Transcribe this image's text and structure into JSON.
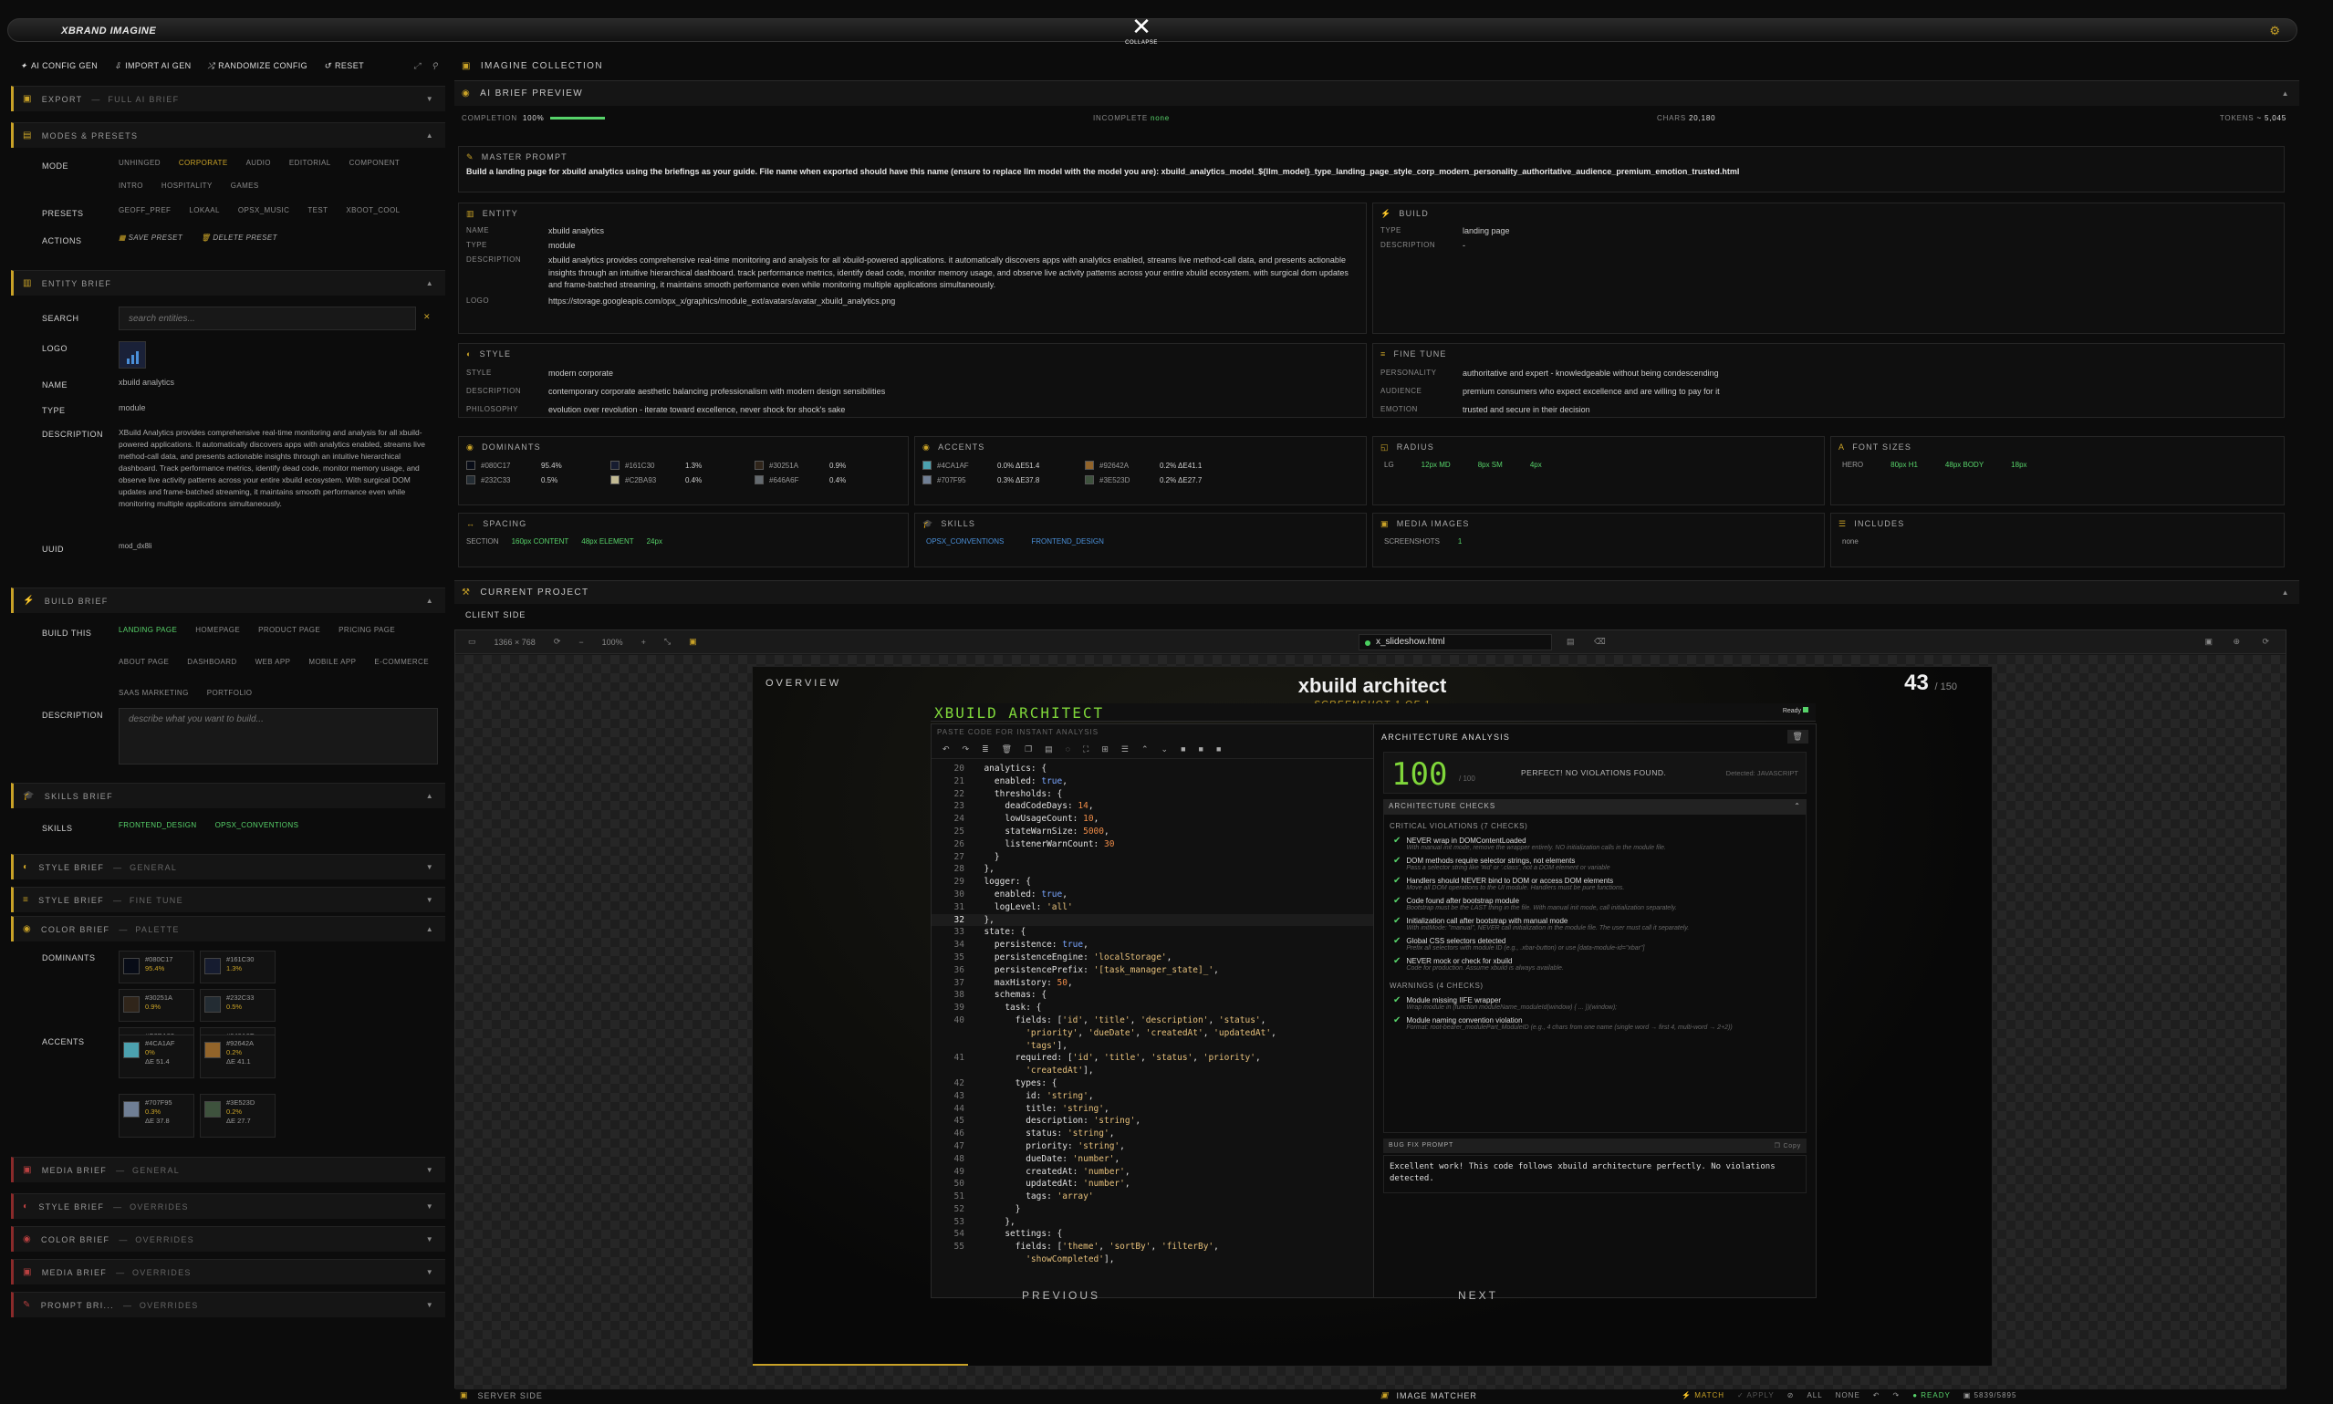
{
  "app": {
    "brand": "XBRAND IMAGINE",
    "collapse": "COLLAPSE"
  },
  "toolbar": {
    "ai_config": "AI CONFIG GEN",
    "import": "IMPORT AI GEN",
    "randomize": "RANDOMIZE CONFIG",
    "reset": "RESET"
  },
  "left": {
    "export": {
      "title": "EXPORT",
      "sub": "FULL AI BRIEF"
    },
    "modes": {
      "title": "MODES & PRESETS",
      "mode_label": "MODE",
      "modes": [
        "UNHINGED",
        "CORPORATE",
        "AUDIO",
        "EDITORIAL",
        "COMPONENT",
        "INTRO",
        "HOSPITALITY",
        "GAMES"
      ],
      "presets_label": "PRESETS",
      "presets": [
        "GEOFF_PREF",
        "LOKAAL",
        "OPSX_MUSIC",
        "TEST",
        "XBOOT_COOL"
      ],
      "actions_label": "ACTIONS",
      "save": "SAVE PRESET",
      "delete": "DELETE PRESET"
    },
    "entity": {
      "title": "ENTITY BRIEF",
      "search_label": "SEARCH",
      "search_placeholder": "search entities...",
      "logo_label": "LOGO",
      "name_label": "NAME",
      "name": "xbuild analytics",
      "type_label": "TYPE",
      "type": "module",
      "desc_label": "DESCRIPTION",
      "desc": "XBuild Analytics provides comprehensive real-time monitoring and analysis for all xbuild-powered applications. It automatically discovers apps with analytics enabled, streams live method-call data, and presents actionable insights through an intuitive hierarchical dashboard. Track performance metrics, identify dead code, monitor memory usage, and observe live activity patterns across your entire xbuild ecosystem. With surgical DOM updates and frame-batched streaming, it maintains smooth performance even while monitoring multiple applications simultaneously.",
      "uuid_label": "UUID",
      "uuid": "mod_dx8li"
    },
    "build": {
      "title": "BUILD BRIEF",
      "build_label": "BUILD THIS",
      "items": [
        "LANDING PAGE",
        "HOMEPAGE",
        "PRODUCT PAGE",
        "PRICING PAGE",
        "ABOUT PAGE",
        "DASHBOARD",
        "WEB APP",
        "MOBILE APP",
        "E-COMMERCE",
        "SAAS MARKETING",
        "PORTFOLIO"
      ],
      "desc_label": "DESCRIPTION",
      "desc_placeholder": "describe what you want to build..."
    },
    "skills": {
      "title": "SKILLS BRIEF",
      "label": "SKILLS",
      "items": [
        "FRONTEND_DESIGN",
        "OPSX_CONVENTIONS"
      ]
    },
    "style_general": {
      "title": "STYLE BRIEF",
      "sub": "GENERAL"
    },
    "style_fine": {
      "title": "STYLE BRIEF",
      "sub": "FINE TUNE"
    },
    "color": {
      "title": "COLOR BRIEF",
      "sub": "PALETTE",
      "dom_label": "DOMINANTS",
      "accent_label": "ACCENTS",
      "dominants": [
        {
          "hex": "#080C17",
          "pct": "95.4%",
          "color": "#080C17"
        },
        {
          "hex": "#161C30",
          "pct": "1.3%",
          "color": "#161C30"
        },
        {
          "hex": "#30251A",
          "pct": "0.9%",
          "color": "#30251A"
        },
        {
          "hex": "#232C33",
          "pct": "0.5%",
          "color": "#232C33"
        },
        {
          "hex": "#C2BA93",
          "pct": "0.4%",
          "color": "#C2BA93"
        },
        {
          "hex": "#646A6F",
          "pct": "0.4%",
          "color": "#646A6F"
        }
      ],
      "accents": [
        {
          "hex": "#4CA1AF",
          "pct": "0%",
          "de": "ΔE 51.4",
          "color": "#4CA1AF"
        },
        {
          "hex": "#92642A",
          "pct": "0.2%",
          "de": "ΔE 41.1",
          "color": "#92642A"
        },
        {
          "hex": "#707F95",
          "pct": "0.3%",
          "de": "ΔE 37.8",
          "color": "#707F95"
        },
        {
          "hex": "#3E523D",
          "pct": "0.2%",
          "de": "ΔE 27.7",
          "color": "#3E523D"
        }
      ]
    },
    "media_general": {
      "title": "MEDIA BRIEF",
      "sub": "GENERAL"
    },
    "style_over": {
      "title": "STYLE BRIEF",
      "sub": "OVERRIDES"
    },
    "color_over": {
      "title": "COLOR BRIEF",
      "sub": "OVERRIDES"
    },
    "media_over": {
      "title": "MEDIA BRIEF",
      "sub": "OVERRIDES"
    },
    "prompt_over": {
      "title": "PROMPT BRI...",
      "sub": "OVERRIDES"
    }
  },
  "right": {
    "collection": "IMAGINE COLLECTION",
    "preview": "AI BRIEF PREVIEW",
    "stats": {
      "completion_label": "COMPLETION",
      "completion": "100%",
      "completion_frac": 1.0,
      "incomplete_label": "INCOMPLETE",
      "incomplete": "none",
      "chars_label": "CHARS",
      "chars": "20,180",
      "tokens_label": "TOKENS",
      "tokens": "~ 5,045"
    },
    "master": {
      "title": "MASTER PROMPT",
      "text": "Build a landing page for xbuild analytics using the briefings as your guide. File name when exported should have this name (ensure to replace llm model with the model you are): xbuild_analytics_model_${llm_model}_type_landing_page_style_corp_modern_personality_authoritative_audience_premium_emotion_trusted.html"
    },
    "entity": {
      "title": "ENTITY",
      "name_k": "NAME",
      "name": "xbuild analytics",
      "type_k": "TYPE",
      "type": "module",
      "desc_k": "DESCRIPTION",
      "desc": "xbuild analytics provides comprehensive real-time monitoring and analysis for all xbuild-powered applications. it automatically discovers apps with analytics enabled, streams live method-call data, and presents actionable insights through an intuitive hierarchical dashboard. track performance metrics, identify dead code, monitor memory usage, and observe live activity patterns across your entire xbuild ecosystem. with surgical dom updates and frame-batched streaming, it maintains smooth performance even while monitoring multiple applications simultaneously.",
      "logo_k": "LOGO",
      "logo": "https://storage.googleapis.com/opx_x/graphics/module_ext/avatars/avatar_xbuild_analytics.png"
    },
    "build": {
      "title": "BUILD",
      "type_k": "TYPE",
      "type": "landing page",
      "desc_k": "DESCRIPTION",
      "desc": "-"
    },
    "style": {
      "title": "STYLE",
      "style_k": "STYLE",
      "style": "modern corporate",
      "desc_k": "DESCRIPTION",
      "desc": "contemporary corporate aesthetic balancing professionalism with modern design sensibilities",
      "phil_k": "PHILOSOPHY",
      "phil": "evolution over revolution - iterate toward excellence, never shock for shock's sake"
    },
    "fine": {
      "title": "FINE TUNE",
      "pers_k": "PERSONALITY",
      "pers": "authoritative and expert - knowledgeable without being condescending",
      "aud_k": "AUDIENCE",
      "aud": "premium consumers who expect excellence and are willing to pay for it",
      "emo_k": "EMOTION",
      "emo": "trusted and secure in their decision"
    },
    "dominants": {
      "title": "DOMINANTS",
      "items": [
        {
          "hex": "#080C17",
          "pct": "95.4%",
          "color": "#080C17"
        },
        {
          "hex": "#161C30",
          "pct": "1.3%",
          "color": "#161C30"
        },
        {
          "hex": "#30251A",
          "pct": "0.9%",
          "color": "#30251A"
        },
        {
          "hex": "#232C33",
          "pct": "0.5%",
          "color": "#232C33"
        },
        {
          "hex": "#C2BA93",
          "pct": "0.4%",
          "color": "#C2BA93"
        },
        {
          "hex": "#646A6F",
          "pct": "0.4%",
          "color": "#646A6F"
        }
      ]
    },
    "accents": {
      "title": "ACCENTS",
      "items": [
        {
          "hex": "#4CA1AF",
          "pct": "0.0% ΔE51.4",
          "color": "#4CA1AF"
        },
        {
          "hex": "#92642A",
          "pct": "0.2% ΔE41.1",
          "color": "#92642A"
        },
        {
          "hex": "#707F95",
          "pct": "0.3% ΔE37.8",
          "color": "#707F95"
        },
        {
          "hex": "#3E523D",
          "pct": "0.2% ΔE27.7",
          "color": "#3E523D"
        }
      ]
    },
    "radius": {
      "title": "RADIUS",
      "k": "LG",
      "vals": [
        "12px MD",
        "8px SM",
        "4px"
      ]
    },
    "fonts": {
      "title": "FONT SIZES",
      "k": "HERO",
      "vals": [
        "80px H1",
        "48px BODY",
        "18px"
      ]
    },
    "spacing": {
      "title": "SPACING",
      "k": "SECTION",
      "vals": [
        "160px CONTENT",
        "48px ELEMENT",
        "24px"
      ]
    },
    "skills": {
      "title": "SKILLS",
      "items": [
        "OPSX_CONVENTIONS",
        "FRONTEND_DESIGN"
      ]
    },
    "media": {
      "title": "MEDIA IMAGES",
      "k": "SCREENSHOTS",
      "v": "1"
    },
    "includes": {
      "title": "INCLUDES",
      "v": "none"
    },
    "project": {
      "title": "CURRENT PROJECT",
      "client": "CLIENT SIDE",
      "server": "SERVER SIDE"
    },
    "browser": {
      "size": "1366 × 768",
      "zoom": "100%",
      "url": "x_slideshow.html"
    },
    "slide": {
      "overview": "OVERVIEW",
      "title": "xbuild architect",
      "subtitle": "SCREENSHOT 1 OF 1",
      "count": "43",
      "total": "/ 150",
      "prev": "PREVIOUS",
      "next": "NEXT",
      "app_title": "XBUILD ARCHITECT",
      "ready": "Ready",
      "paste": "PASTE CODE FOR INSTANT ANALYSIS",
      "code": [
        {
          "n": "20",
          "t": "  analytics: {"
        },
        {
          "n": "21",
          "t": "    enabled: true,"
        },
        {
          "n": "22",
          "t": "    thresholds: {"
        },
        {
          "n": "23",
          "t": "      deadCodeDays: 14,"
        },
        {
          "n": "24",
          "t": "      lowUsageCount: 10,"
        },
        {
          "n": "25",
          "t": "      stateWarnSize: 5000,"
        },
        {
          "n": "26",
          "t": "      listenerWarnCount: 30"
        },
        {
          "n": "27",
          "t": "    }"
        },
        {
          "n": "28",
          "t": "  },"
        },
        {
          "n": "29",
          "t": "  logger: {"
        },
        {
          "n": "30",
          "t": "    enabled: true,"
        },
        {
          "n": "31",
          "t": "    logLevel: 'all'"
        },
        {
          "n": "32",
          "t": "  },"
        },
        {
          "n": "33",
          "t": "  state: {"
        },
        {
          "n": "34",
          "t": "    persistence: true,"
        },
        {
          "n": "35",
          "t": "    persistenceEngine: 'localStorage',"
        },
        {
          "n": "36",
          "t": "    persistencePrefix: '[task_manager_state]_',"
        },
        {
          "n": "37",
          "t": "    maxHistory: 50,"
        },
        {
          "n": "38",
          "t": "    schemas: {"
        },
        {
          "n": "39",
          "t": "      task: {"
        },
        {
          "n": "40",
          "t": "        fields: ['id', 'title', 'description', 'status',"
        },
        {
          "n": "",
          "t": "          'priority', 'dueDate', 'createdAt', 'updatedAt',"
        },
        {
          "n": "",
          "t": "          'tags'],"
        },
        {
          "n": "41",
          "t": "        required: ['id', 'title', 'status', 'priority',"
        },
        {
          "n": "",
          "t": "          'createdAt'],"
        },
        {
          "n": "42",
          "t": "        types: {"
        },
        {
          "n": "43",
          "t": "          id: 'string',"
        },
        {
          "n": "44",
          "t": "          title: 'string',"
        },
        {
          "n": "45",
          "t": "          description: 'string',"
        },
        {
          "n": "46",
          "t": "          status: 'string',"
        },
        {
          "n": "47",
          "t": "          priority: 'string',"
        },
        {
          "n": "48",
          "t": "          dueDate: 'number',"
        },
        {
          "n": "49",
          "t": "          createdAt: 'number',"
        },
        {
          "n": "50",
          "t": "          updatedAt: 'number',"
        },
        {
          "n": "51",
          "t": "          tags: 'array'"
        },
        {
          "n": "52",
          "t": "        }"
        },
        {
          "n": "53",
          "t": "      },"
        },
        {
          "n": "54",
          "t": "      settings: {"
        },
        {
          "n": "55",
          "t": "        fields: ['theme', 'sortBy', 'filterBy',"
        },
        {
          "n": "",
          "t": "          'showCompleted'],"
        }
      ],
      "analysis_title": "ARCHITECTURE ANALYSIS",
      "score": "100",
      "score_total": "/ 100",
      "perfect": "PERFECT! NO VIOLATIONS FOUND.",
      "detected": "Detected: JAVASCRIPT",
      "checks_title": "ARCHITECTURE CHECKS",
      "critical_title": "CRITICAL VIOLATIONS (7 CHECKS)",
      "critical": [
        {
          "t": "NEVER wrap in DOMContentLoaded",
          "d": "With manual init mode, remove the wrapper entirely. NO initialization calls in the module file."
        },
        {
          "t": "DOM methods require selector strings, not elements",
          "d": "Pass a selector string like '#id' or '.class', not a DOM element or variable"
        },
        {
          "t": "Handlers should NEVER bind to DOM or access DOM elements",
          "d": "Move all DOM operations to the UI module. Handlers must be pure functions."
        },
        {
          "t": "Code found after bootstrap module",
          "d": "Bootstrap must be the LAST thing in the file. With manual init mode, call initialization separately."
        },
        {
          "t": "Initialization call after bootstrap with manual mode",
          "d": "With initMode: \"manual\", NEVER call initialization in the module file. The user must call it separately."
        },
        {
          "t": "Global CSS selectors detected",
          "d": "Prefix all selectors with module ID (e.g., .xbar-button) or use [data-module-id=\"xbar\"]"
        },
        {
          "t": "NEVER mock or check for xbuild",
          "d": "Code for production. Assume xbuild is always available."
        }
      ],
      "warnings_title": "WARNINGS (4 CHECKS)",
      "warnings": [
        {
          "t": "Module missing IIFE wrapper",
          "d": "Wrap module in (function moduleName_moduleId(window) { ... })(window);"
        },
        {
          "t": "Module naming convention violation",
          "d": "Format: root-bearer_modulePart_ModuleID (e.g., 4 chars from one name (single word → first 4, multi-word → 2+2))"
        }
      ],
      "bugfix_title": "BUG FIX PROMPT",
      "copy": "Copy",
      "bugfix": "Excellent work! This code follows xbuild architecture perfectly. No violations detected."
    },
    "statusbar": {
      "matcher": "IMAGE MATCHER",
      "match": "MATCH",
      "apply": "APPLY",
      "all": "ALL",
      "none": "NONE",
      "ready": "READY",
      "dims": "5839/5895"
    }
  }
}
